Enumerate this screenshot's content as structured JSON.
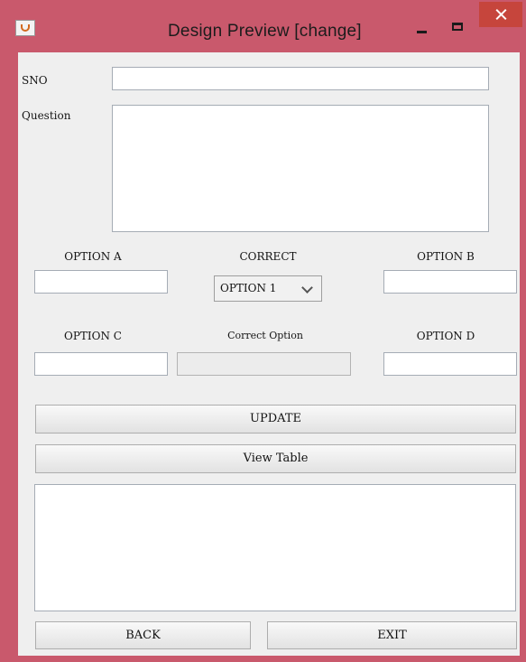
{
  "window": {
    "title": "Design Preview [change]",
    "colors": {
      "frame": "#c9596c",
      "close": "#c6453c",
      "panel": "#efefef"
    },
    "icons": {
      "app": "java-icon",
      "minimize": "minimize-icon",
      "maximize": "maximize-icon",
      "close": "close-icon"
    }
  },
  "form": {
    "sno_label": "SNO",
    "sno_value": "",
    "question_label": "Question",
    "question_value": "",
    "option_a_label": "OPTION A",
    "option_a_value": "",
    "correct_label": "CORRECT",
    "correct_select_value": "OPTION 1",
    "option_b_label": "OPTION B",
    "option_b_value": "",
    "option_c_label": "OPTION C",
    "option_c_value": "",
    "correct_option_label": "Correct Option",
    "correct_option_value": "",
    "option_d_label": "OPTION D",
    "option_d_value": ""
  },
  "actions": {
    "update_label": "UPDATE",
    "view_table_label": "View Table",
    "back_label": "BACK",
    "exit_label": "EXIT"
  },
  "output": {
    "value": ""
  }
}
